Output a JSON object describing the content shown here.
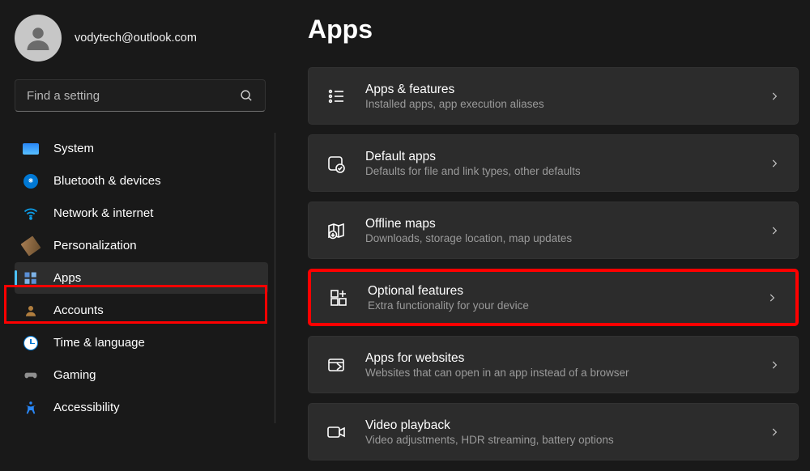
{
  "user": {
    "email": "vodytech@outlook.com"
  },
  "search": {
    "placeholder": "Find a setting"
  },
  "sidebar": {
    "items": [
      {
        "label": "System"
      },
      {
        "label": "Bluetooth & devices"
      },
      {
        "label": "Network & internet"
      },
      {
        "label": "Personalization"
      },
      {
        "label": "Apps"
      },
      {
        "label": "Accounts"
      },
      {
        "label": "Time & language"
      },
      {
        "label": "Gaming"
      },
      {
        "label": "Accessibility"
      }
    ]
  },
  "page": {
    "title": "Apps"
  },
  "cards": [
    {
      "title": "Apps & features",
      "subtitle": "Installed apps, app execution aliases"
    },
    {
      "title": "Default apps",
      "subtitle": "Defaults for file and link types, other defaults"
    },
    {
      "title": "Offline maps",
      "subtitle": "Downloads, storage location, map updates"
    },
    {
      "title": "Optional features",
      "subtitle": "Extra functionality for your device"
    },
    {
      "title": "Apps for websites",
      "subtitle": "Websites that can open in an app instead of a browser"
    },
    {
      "title": "Video playback",
      "subtitle": "Video adjustments, HDR streaming, battery options"
    }
  ]
}
